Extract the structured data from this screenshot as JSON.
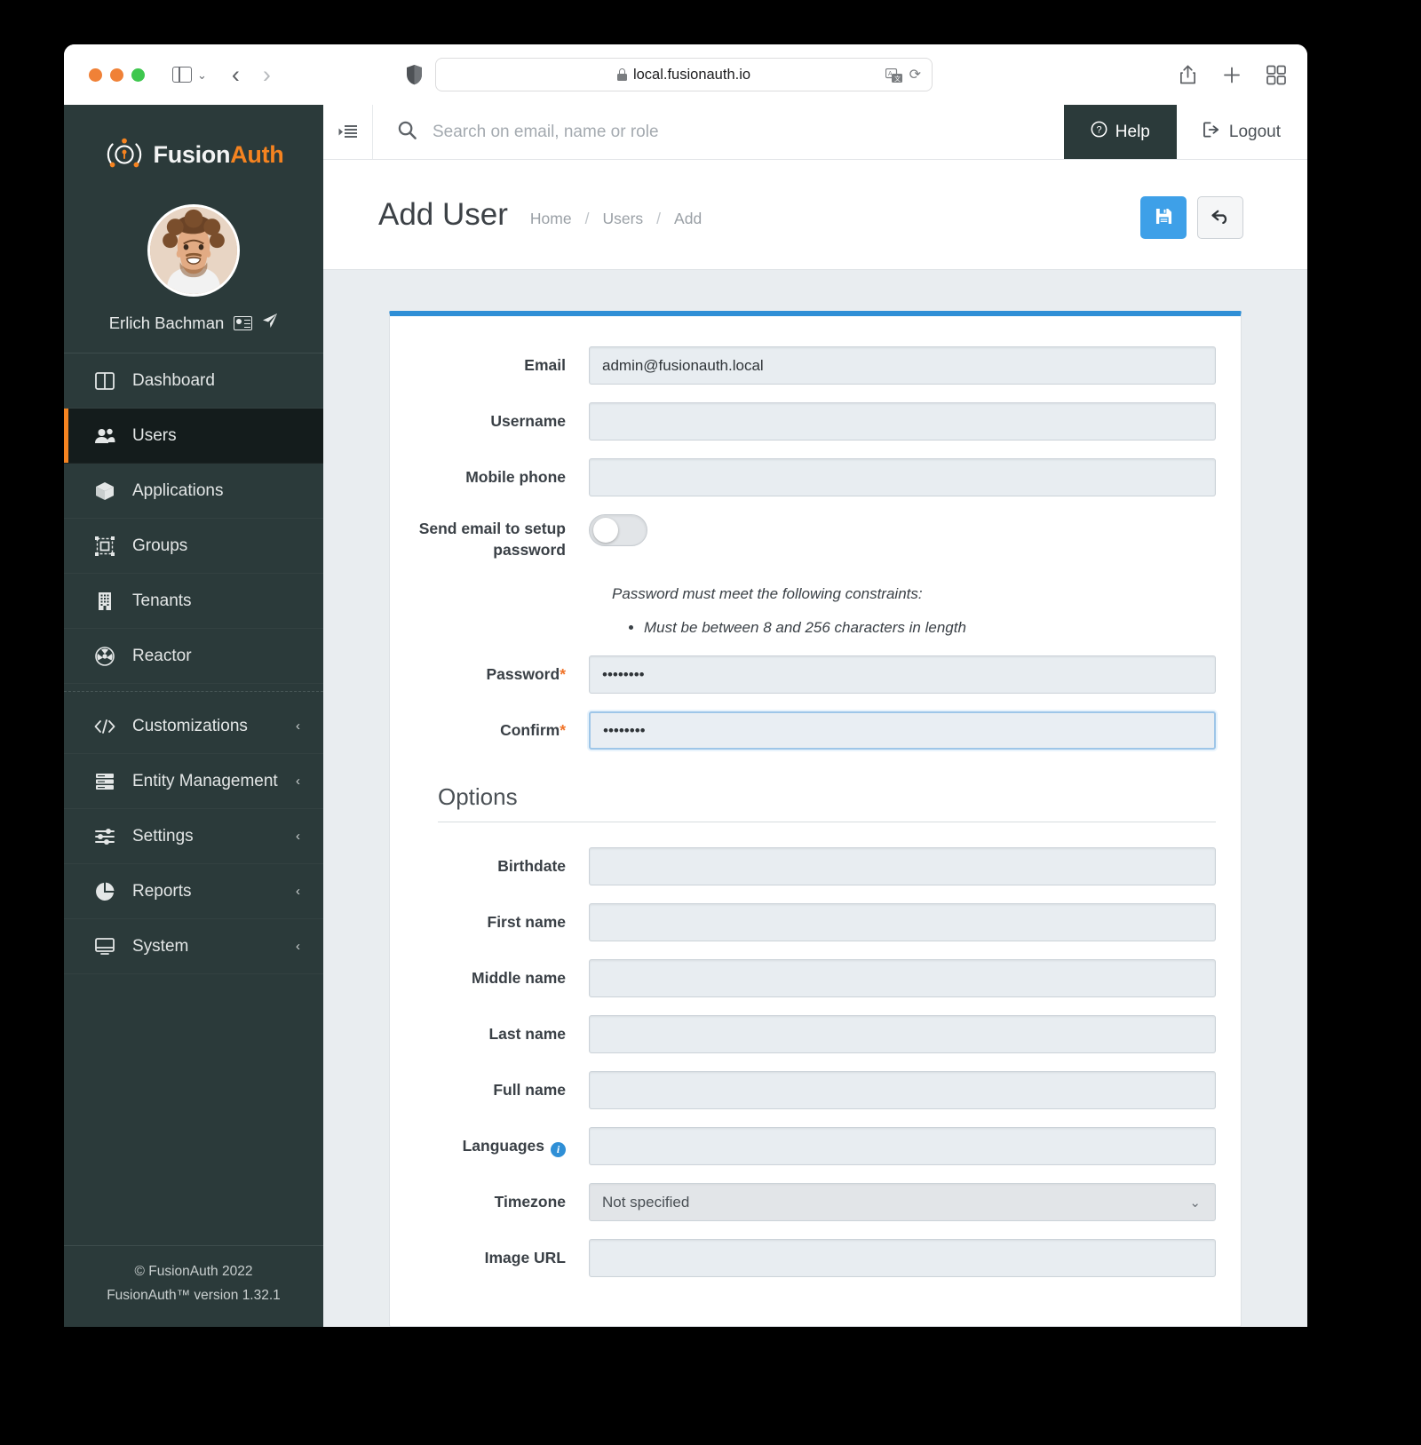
{
  "browser": {
    "url": "local.fusionauth.io",
    "lock_icon": "lock-icon",
    "shield_icon": "shield-icon",
    "translate_icon": "translate-icon",
    "reload_icon": "reload-icon",
    "back_icon": "chevron-left-icon",
    "forward_icon": "chevron-right-icon",
    "sidebar_icon": "sidebar-toggle-icon",
    "share_icon": "share-icon",
    "newtab_icon": "plus-icon",
    "tabs_icon": "tab-overview-icon"
  },
  "sidebar": {
    "brand": {
      "part1": "Fusion",
      "part2": "Auth",
      "logo_icon": "fusionauth-logo-icon"
    },
    "user": {
      "name": "Erlich Bachman",
      "idcard_icon": "id-card-icon",
      "send_icon": "paper-plane-icon"
    },
    "items": [
      {
        "label": "Dashboard",
        "icon": "dashboard-icon",
        "active": false,
        "expandable": false
      },
      {
        "label": "Users",
        "icon": "users-icon",
        "active": true,
        "expandable": false
      },
      {
        "label": "Applications",
        "icon": "box-icon",
        "active": false,
        "expandable": false
      },
      {
        "label": "Groups",
        "icon": "groups-icon",
        "active": false,
        "expandable": false
      },
      {
        "label": "Tenants",
        "icon": "building-icon",
        "active": false,
        "expandable": false
      },
      {
        "label": "Reactor",
        "icon": "reactor-icon",
        "active": false,
        "expandable": false
      }
    ],
    "items2": [
      {
        "label": "Customizations",
        "icon": "code-icon",
        "active": false,
        "expandable": true
      },
      {
        "label": "Entity Management",
        "icon": "server-icon",
        "active": false,
        "expandable": true
      },
      {
        "label": "Settings",
        "icon": "sliders-icon",
        "active": false,
        "expandable": true
      },
      {
        "label": "Reports",
        "icon": "pie-chart-icon",
        "active": false,
        "expandable": true
      },
      {
        "label": "System",
        "icon": "monitor-icon",
        "active": false,
        "expandable": true
      }
    ],
    "footer_line1": "© FusionAuth 2022",
    "footer_line2": "FusionAuth™ version 1.32.1"
  },
  "topbar": {
    "collapse_icon": "collapse-sidebar-icon",
    "search_icon": "search-icon",
    "search_placeholder": "Search on email, name or role",
    "search_value": "",
    "help_label": "Help",
    "help_icon": "question-circle-icon",
    "logout_label": "Logout",
    "logout_icon": "logout-icon"
  },
  "page": {
    "title": "Add User",
    "breadcrumbs": [
      "Home",
      "Users",
      "Add"
    ],
    "breadcrumb_sep": "/",
    "save_icon": "save-floppy-icon",
    "back_icon": "undo-arrow-icon"
  },
  "form": {
    "accent_color": "#2f8fd6",
    "fields": [
      {
        "label": "Email",
        "value": "admin@fusionauth.local",
        "required": false,
        "type": "text",
        "focused": false
      },
      {
        "label": "Username",
        "value": "",
        "required": false,
        "type": "text",
        "focused": false
      },
      {
        "label": "Mobile phone",
        "value": "",
        "required": false,
        "type": "text",
        "focused": false
      }
    ],
    "toggle": {
      "label": "Send email to setup password",
      "checked": false
    },
    "constraints_title": "Password must meet the following constraints:",
    "constraints": [
      "Must be between 8 and 256 characters in length"
    ],
    "password": {
      "label": "Password",
      "required": true,
      "value": "••••••••",
      "focused": false
    },
    "confirm": {
      "label": "Confirm",
      "required": true,
      "value": "••••••••",
      "focused": true
    },
    "options_title": "Options",
    "options_fields": [
      {
        "label": "Birthdate",
        "value": "",
        "type": "text",
        "info": false
      },
      {
        "label": "First name",
        "value": "",
        "type": "text",
        "info": false
      },
      {
        "label": "Middle name",
        "value": "",
        "type": "text",
        "info": false
      },
      {
        "label": "Last name",
        "value": "",
        "type": "text",
        "info": false
      },
      {
        "label": "Full name",
        "value": "",
        "type": "text",
        "info": false
      },
      {
        "label": "Languages",
        "value": "",
        "type": "text",
        "info": true
      },
      {
        "label": "Timezone",
        "value": "Not specified",
        "type": "select",
        "info": false
      },
      {
        "label": "Image URL",
        "value": "",
        "type": "text",
        "info": false
      }
    ],
    "required_marker": "*"
  }
}
